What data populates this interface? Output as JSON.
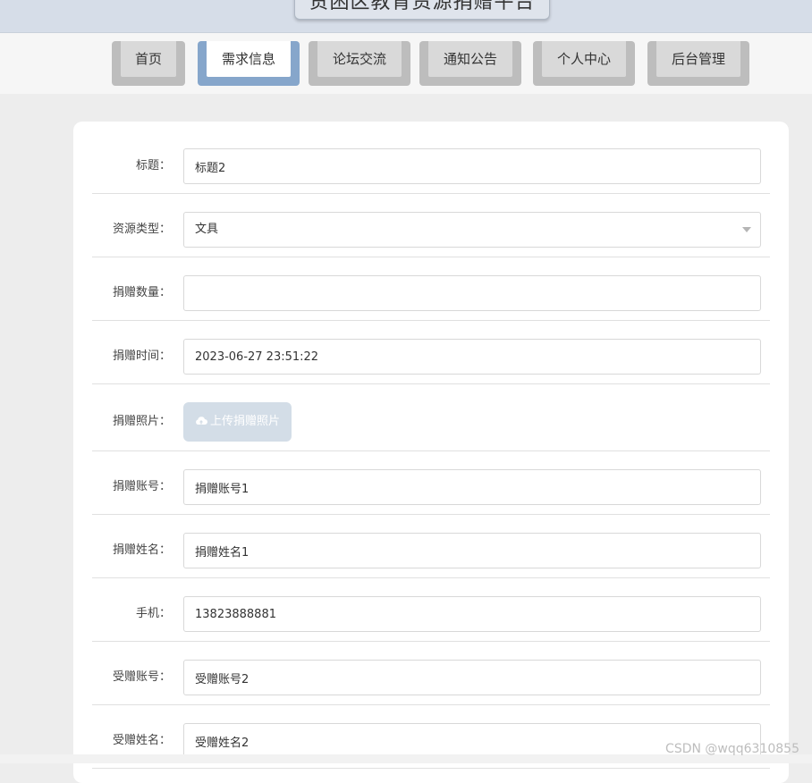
{
  "site": {
    "title": "贵困区教育资源捐赠平台"
  },
  "nav": {
    "items": [
      {
        "label": "首页"
      },
      {
        "label": "需求信息"
      },
      {
        "label": "论坛交流"
      },
      {
        "label": "通知公告"
      },
      {
        "label": "个人中心"
      },
      {
        "label": "后台管理"
      }
    ],
    "active": "需求信息"
  },
  "form": {
    "fields": [
      {
        "label": "标题：",
        "value": "标题2"
      },
      {
        "label": "资源类型：",
        "value": "文具"
      },
      {
        "label": "捐赠数量：",
        "value": ""
      },
      {
        "label": "捐赠时间：",
        "value": "2023-06-27 23:51:22"
      },
      {
        "label": "捐赠照片：",
        "button": "上传捐赠照片"
      },
      {
        "label": "捐赠账号：",
        "value": "捐赠账号1"
      },
      {
        "label": "捐赠姓名：",
        "value": "捐赠姓名1"
      },
      {
        "label": "手机：",
        "value": "13823888881"
      },
      {
        "label": "受赠账号：",
        "value": "受赠账号2"
      },
      {
        "label": "受赠姓名：",
        "value": "受赠姓名2"
      }
    ]
  },
  "watermark": "CSDN @wqq6310855",
  "icons": {
    "upload": "cloud-upload-icon",
    "dropdown": "chevron-down-icon"
  },
  "colors": {
    "accent": "#86a6cb",
    "upload_button": "#d3dde7"
  }
}
